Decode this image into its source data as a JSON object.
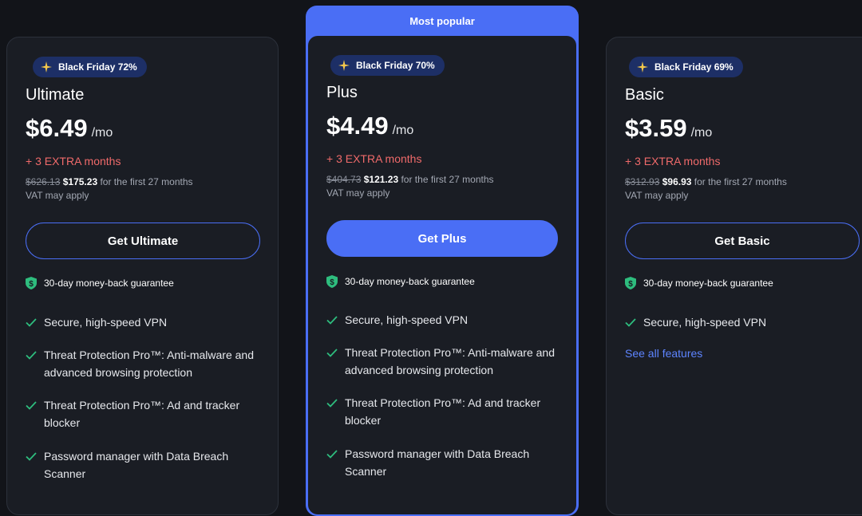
{
  "popular_label": "Most popular",
  "guarantee": "30-day money-back guarantee",
  "colors": {
    "accent": "#4a6ef5",
    "extra": "#f06a6a",
    "check": "#2ebd7e",
    "background": "#121419"
  },
  "plans": [
    {
      "badge": "Black Friday 72%",
      "name": "Ultimate",
      "price": "$6.49",
      "per": "/mo",
      "extra": "+ 3 EXTRA months",
      "old_price": "$626.13",
      "new_price": "$175.23",
      "terms": "for the first 27 months",
      "vat": "VAT may apply",
      "button": "Get Ultimate",
      "features": [
        "Secure, high-speed VPN",
        "Threat Protection Pro™: Anti-malware and advanced browsing protection",
        "Threat Protection Pro™: Ad and tracker blocker",
        "Password manager with Data Breach Scanner"
      ]
    },
    {
      "badge": "Black Friday 70%",
      "name": "Plus",
      "price": "$4.49",
      "per": "/mo",
      "extra": "+ 3 EXTRA months",
      "old_price": "$404.73",
      "new_price": "$121.23",
      "terms": "for the first 27 months",
      "vat": "VAT may apply",
      "button": "Get Plus",
      "features": [
        "Secure, high-speed VPN",
        "Threat Protection Pro™: Anti-malware and advanced browsing protection",
        "Threat Protection Pro™: Ad and tracker blocker",
        "Password manager with Data Breach Scanner"
      ]
    },
    {
      "badge": "Black Friday 69%",
      "name": "Basic",
      "price": "$3.59",
      "per": "/mo",
      "extra": "+ 3 EXTRA months",
      "old_price": "$312.93",
      "new_price": "$96.93",
      "terms": "for the first 27 months",
      "vat": "VAT may apply",
      "button": "Get Basic",
      "features": [
        "Secure, high-speed VPN"
      ],
      "see_all": "See all features"
    }
  ]
}
